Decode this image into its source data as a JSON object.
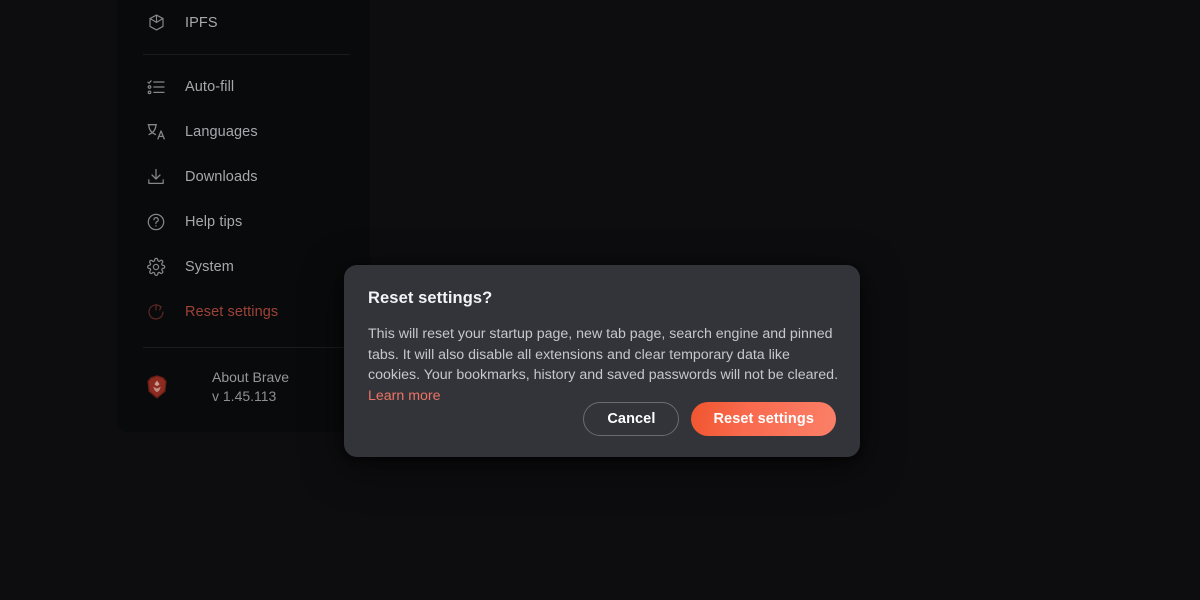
{
  "sidebar": {
    "items": [
      {
        "label": "IPFS",
        "icon": "cube-icon",
        "danger": false
      },
      {
        "label": "Auto-fill",
        "icon": "checklist-icon",
        "danger": false
      },
      {
        "label": "Languages",
        "icon": "translate-icon",
        "danger": false
      },
      {
        "label": "Downloads",
        "icon": "download-icon",
        "danger": false
      },
      {
        "label": "Help tips",
        "icon": "question-circle-icon",
        "danger": false
      },
      {
        "label": "System",
        "icon": "gear-icon",
        "danger": false
      },
      {
        "label": "Reset settings",
        "icon": "reset-icon",
        "danger": true
      }
    ],
    "about": {
      "title": "About Brave",
      "version": "v 1.45.113",
      "icon": "brave-lion-icon"
    }
  },
  "dialog": {
    "title": "Reset settings?",
    "body_text": "This will reset your startup page, new tab page, search engine and pinned tabs. It will also disable all extensions and clear temporary data like cookies. Your bookmarks, history and saved passwords will not be cleared. ",
    "learn_more_label": "Learn more",
    "cancel_label": "Cancel",
    "confirm_label": "Reset settings"
  },
  "colors": {
    "page_background": "#0d0d0f",
    "sidebar_background": "#090a0b",
    "dialog_background": "#33343a",
    "danger_text": "#9e4338",
    "accent_link": "#ec7364",
    "primary_button_gradient_start": "#f0552e",
    "primary_button_gradient_end": "#fa8068",
    "label_text": "#a7a8ad"
  }
}
